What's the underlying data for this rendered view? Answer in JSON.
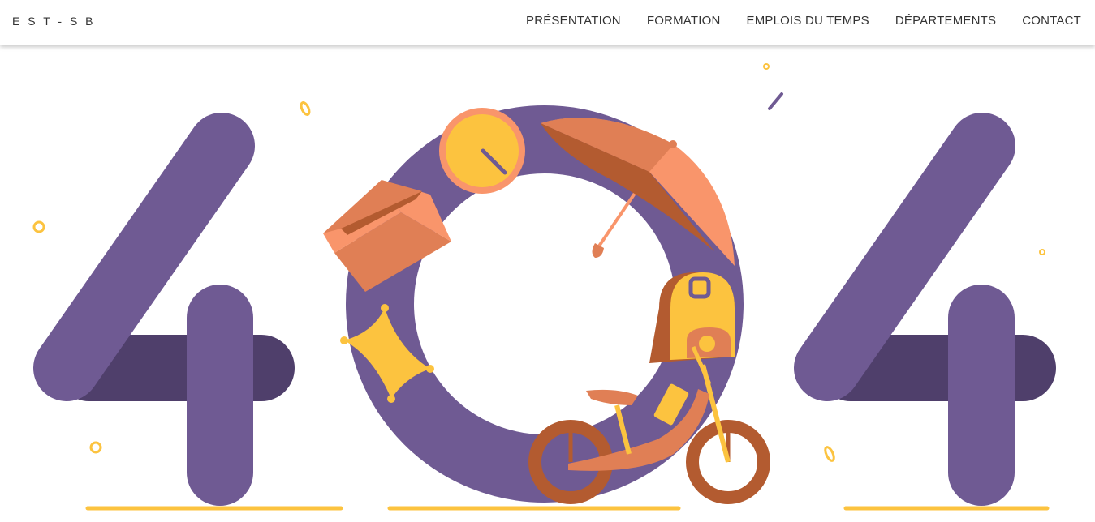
{
  "brand": "E S T - S B",
  "nav": {
    "items": [
      {
        "label": "PRÉSENTATION"
      },
      {
        "label": "FORMATION"
      },
      {
        "label": "EMPLOIS DU TEMPS"
      },
      {
        "label": "DÉPARTEMENTS"
      },
      {
        "label": "CONTACT"
      }
    ]
  },
  "illustration": {
    "subject": "404",
    "colors": {
      "purple": "#6f5a93",
      "purple_dark": "#4f3f6b",
      "yellow": "#fcc33f",
      "orange": "#f9956b",
      "orange_mid": "#e07f55",
      "brown": "#b35b30"
    }
  }
}
